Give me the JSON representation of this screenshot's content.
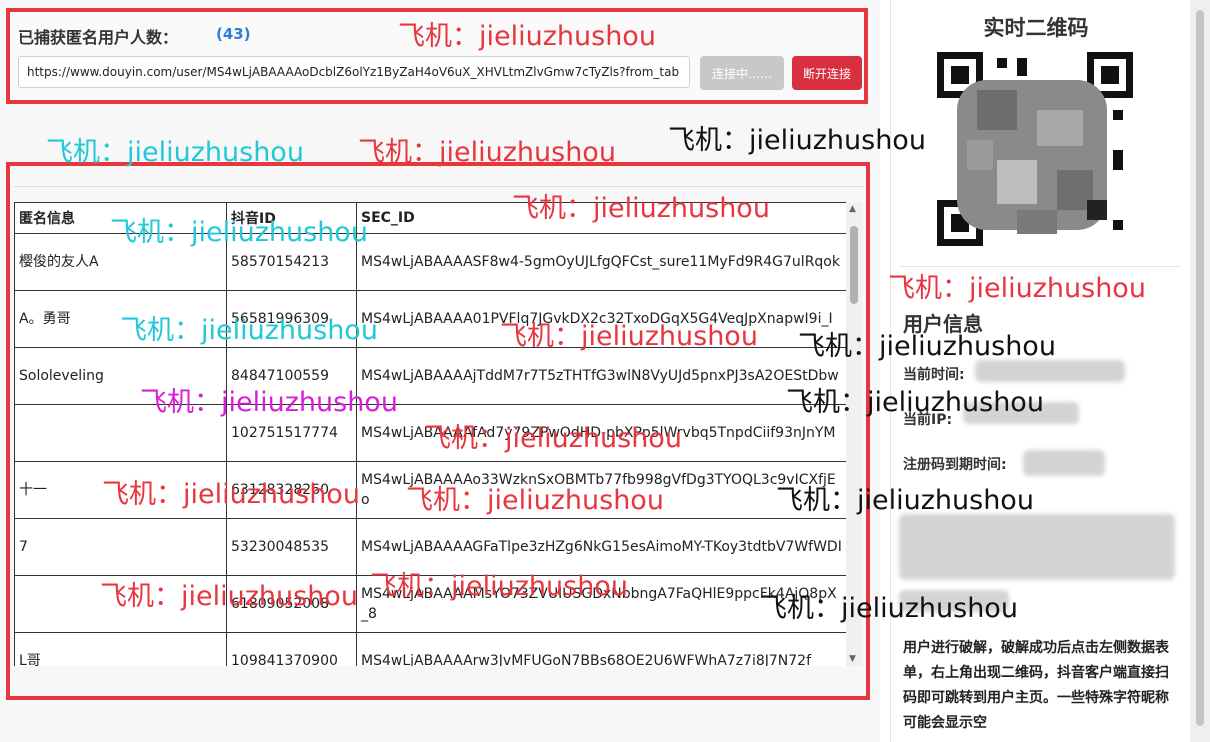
{
  "header": {
    "count_label": "已捕获匿名用户人数：",
    "count_value": "(43)",
    "url_value": "https://www.douyin.com/user/MS4wLjABAAAAoDcblZ6olYz1ByZaH4oV6uX_XHVLtmZlvGmw7cTyZls?from_tab",
    "connect_button": "连接中……",
    "disconnect_button": "断开连接"
  },
  "table": {
    "columns": [
      "匿名信息",
      "抖音ID",
      "SEC_ID"
    ],
    "rows": [
      {
        "name": "樱俊的友人A",
        "id": "58570154213",
        "sec": "MS4wLjABAAAASF8w4-5gmOyUJLfgQFCst_sure11MyFd9R4G7ulRqok"
      },
      {
        "name": "A。勇哥",
        "id": "56581996309",
        "sec": "MS4wLjABAAAA01PVFlq7JGvkDX2c32TxoDGqX5G4VeqJpXnapwI9i_I"
      },
      {
        "name": "Sololeveling",
        "id": "84847100559",
        "sec": "MS4wLjABAAAAjTddM7r7T5zTHTfG3wlN8VyUJd5pnxPJ3sA2OEStDbw"
      },
      {
        "name": "",
        "id": "102751517774",
        "sec": "MS4wLjABAAAAfAd7y79ZPwOdHD-pbXPp5lWrvbq5TnpdCiif93nJnYM"
      },
      {
        "name": "十一",
        "id": "63128328260",
        "sec": "MS4wLjABAAAAo33WzknSxOBMTb77fb998gVfDg3TYOQL3c9vICXfjEo"
      },
      {
        "name": "7",
        "id": "53230048535",
        "sec": "MS4wLjABAAAAGFaTlpe3zHZg6NkG15esAimoMY-TKoy3tdtbV7WfWDI"
      },
      {
        "name": "",
        "id": "61809052008",
        "sec": "MS4wLjABAAAAMsYO73ZVUIUSGDxNbbngA7FaQHlE9ppcFk4AjQ8pX_8"
      },
      {
        "name": "L哥",
        "id": "109841370900",
        "sec": "MS4wLjABAAAArw3JvMFUGoN7BBs68OE2U6WFWhA7z7i8J7N72f"
      }
    ]
  },
  "sidebar": {
    "qr_title": "实时二维码",
    "info_title": "用户信息",
    "current_time_label": "当前时间:",
    "current_ip_label": "当前IP:",
    "reg_expiry_label": "注册码到期时间:",
    "description": "用户进行破解，破解成功后点击左侧数据表单，右上角出现二维码，抖音客户端直接扫码即可跳转到用户主页。一些特殊字符昵称可能会显示空"
  },
  "watermark": {
    "text": "飞机：jieliuzhushou",
    "colors": {
      "red": "#e8363e",
      "cyan": "#20c8d8",
      "black": "#111111",
      "magenta": "#d81fd8"
    }
  },
  "colors": {
    "accent_blue": "#2a7fd4",
    "danger_red": "#d9303f",
    "disabled_gray": "#c8c8c8",
    "frame_red": "#e8363e"
  }
}
